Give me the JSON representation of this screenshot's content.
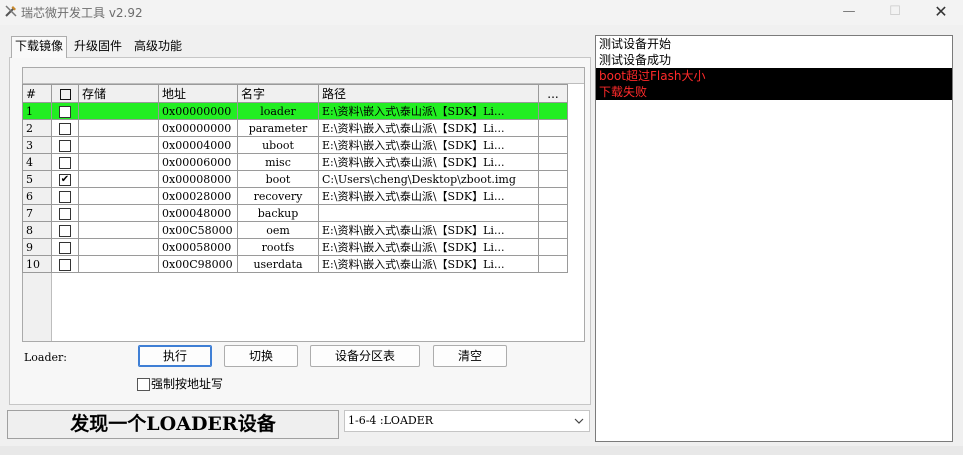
{
  "window": {
    "title": "瑞芯微开发工具 v2.92",
    "minimize_glyph": "—",
    "maximize_glyph": "☐",
    "close_glyph": "✕"
  },
  "tabs": [
    {
      "label": "下载镜像",
      "selected": true
    },
    {
      "label": "升级固件",
      "selected": false
    },
    {
      "label": "高级功能",
      "selected": false
    }
  ],
  "grid": {
    "columns": [
      "#",
      "",
      "存储",
      "地址",
      "名字",
      "路径",
      "..."
    ],
    "rows": [
      {
        "num": "1",
        "checked": false,
        "storage": "",
        "address": "0x00000000",
        "name": "loader",
        "path": "E:\\资料\\嵌入式\\泰山派\\【SDK】Li...",
        "active": true
      },
      {
        "num": "2",
        "checked": false,
        "storage": "",
        "address": "0x00000000",
        "name": "parameter",
        "path": "E:\\资料\\嵌入式\\泰山派\\【SDK】Li...",
        "active": false
      },
      {
        "num": "3",
        "checked": false,
        "storage": "",
        "address": "0x00004000",
        "name": "uboot",
        "path": "E:\\资料\\嵌入式\\泰山派\\【SDK】Li...",
        "active": false
      },
      {
        "num": "4",
        "checked": false,
        "storage": "",
        "address": "0x00006000",
        "name": "misc",
        "path": "E:\\资料\\嵌入式\\泰山派\\【SDK】Li...",
        "active": false
      },
      {
        "num": "5",
        "checked": true,
        "storage": "",
        "address": "0x00008000",
        "name": "boot",
        "path": "C:\\Users\\cheng\\Desktop\\zboot.img",
        "active": false
      },
      {
        "num": "6",
        "checked": false,
        "storage": "",
        "address": "0x00028000",
        "name": "recovery",
        "path": "E:\\资料\\嵌入式\\泰山派\\【SDK】Li...",
        "active": false
      },
      {
        "num": "7",
        "checked": false,
        "storage": "",
        "address": "0x00048000",
        "name": "backup",
        "path": "",
        "active": false
      },
      {
        "num": "8",
        "checked": false,
        "storage": "",
        "address": "0x00C58000",
        "name": "oem",
        "path": "E:\\资料\\嵌入式\\泰山派\\【SDK】Li...",
        "active": false
      },
      {
        "num": "9",
        "checked": false,
        "storage": "",
        "address": "0x00058000",
        "name": "rootfs",
        "path": "E:\\资料\\嵌入式\\泰山派\\【SDK】Li...",
        "active": false
      },
      {
        "num": "10",
        "checked": false,
        "storage": "",
        "address": "0x00C98000",
        "name": "userdata",
        "path": "E:\\资料\\嵌入式\\泰山派\\【SDK】Li...",
        "active": false
      }
    ]
  },
  "controls": {
    "loader_label": "Loader:",
    "execute": "执行",
    "switch": "切换",
    "partition": "设备分区表",
    "clear": "清空",
    "force_address": "强制按地址写"
  },
  "status": {
    "message": "发现一个LOADER设备",
    "device_selected": "1-6-4 :LOADER"
  },
  "log": [
    {
      "text": "测试设备开始",
      "error": false
    },
    {
      "text": "测试设备成功",
      "error": false
    },
    {
      "text": "boot超过Flash大小",
      "error": true
    },
    {
      "text": "下载失败",
      "error": true
    }
  ],
  "colors": {
    "active_row": "#22ee22",
    "error_bg": "#000000",
    "error_text": "#ff2a2a"
  }
}
